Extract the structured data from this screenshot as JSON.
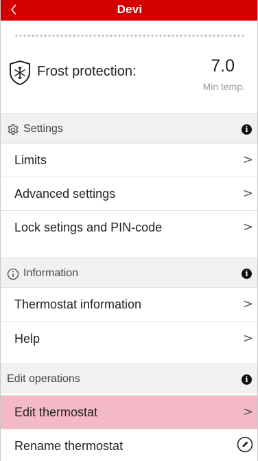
{
  "header": {
    "title": "Devi",
    "back_glyph": "<",
    "bar_color": "#d40000"
  },
  "frost": {
    "icon": "shield-snowflake-icon",
    "label": "Frost protection:",
    "value": "7.0",
    "unit": "Min temp."
  },
  "sections": {
    "settings": {
      "label": "Settings",
      "icon": "gear-icon",
      "info_glyph": "i",
      "items": [
        {
          "label": "Limits",
          "chevron": ">"
        },
        {
          "label": "Advanced settings",
          "chevron": ">"
        },
        {
          "label": "Lock setings and PIN-code",
          "chevron": ">"
        }
      ]
    },
    "information": {
      "label": "Information",
      "icon": "info-circle-icon",
      "info_glyph": "i",
      "items": [
        {
          "label": "Thermostat information",
          "chevron": ">"
        },
        {
          "label": "Help",
          "chevron": ">"
        }
      ]
    },
    "edit_operations": {
      "label": "Edit operations",
      "info_glyph": "i",
      "items": [
        {
          "label": "Edit thermostat",
          "chevron": ">",
          "highlight_color": "#f4b9c6"
        },
        {
          "label": "Rename thermostat",
          "icon": "pencil-circle-icon"
        }
      ]
    }
  }
}
